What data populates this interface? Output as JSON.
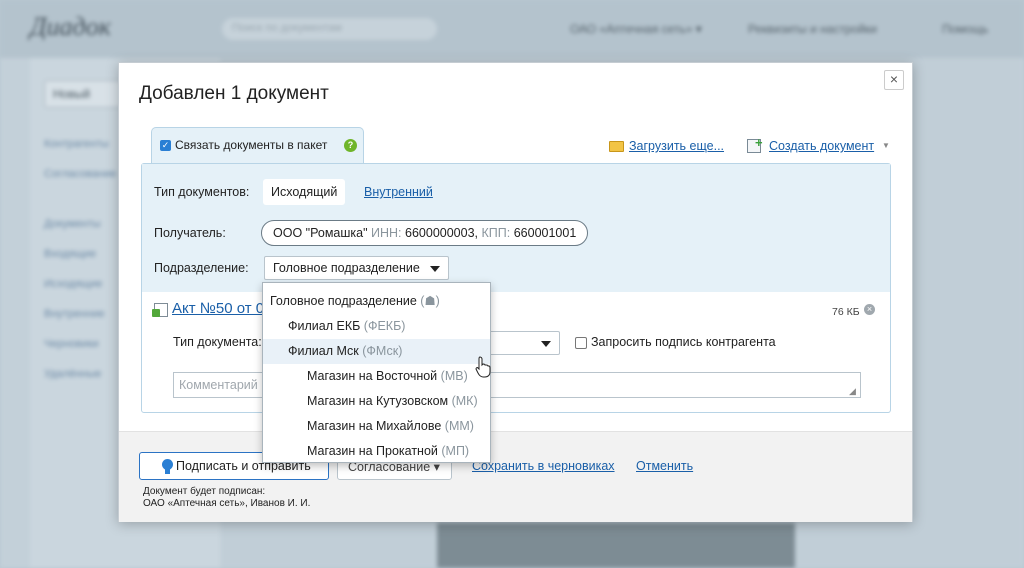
{
  "background": {
    "logo": "Диадок",
    "search_placeholder": "Поиск по документам",
    "org": "ОАО «Аптечная сеть» ▾",
    "settings": "Реквизиты и настройки",
    "help": "Помощь",
    "new_button": "Новый",
    "sidebar_links": [
      "Контрагенты",
      "Согласование",
      "Документы",
      "Входящие",
      "Исходящие",
      "Внутренние",
      "Черновики",
      "Удалённые"
    ]
  },
  "modal": {
    "title": "Добавлен 1 документ",
    "close": "×",
    "tab": {
      "label": "Связать документы в пакет",
      "help": "?"
    },
    "upload_more": "Загрузить еще...",
    "create_document": "Создать документ",
    "doc_types": {
      "label": "Тип документов:",
      "active": "Исходящий",
      "other": "Внутренний"
    },
    "recipient": {
      "label": "Получатель:",
      "name": "ООО \"Ромашка\"",
      "inn_label": "ИНН:",
      "inn": "6600000003,",
      "kpp_label": "КПП:",
      "kpp": "660001001"
    },
    "subdivision": {
      "label": "Подразделение:",
      "value": "Головное подразделение"
    },
    "document": {
      "link": "Акт №50 от 0",
      "size": "76 КБ",
      "type_label": "Тип документа:",
      "request_signature": "Запросить подпись контрагента",
      "comment_placeholder": "Комментарий"
    },
    "footer": {
      "sign_button": "Подписать и отправить",
      "approve_button": "Согласование ▾",
      "save_draft": "Сохранить в черновиках",
      "cancel": "Отменить",
      "note_line1": "Документ будет подписан:",
      "note_line2": "ОАО «Аптечная сеть», Иванов И. И."
    }
  },
  "dropdown": {
    "items": [
      {
        "name": "Головное подразделение",
        "abbr": "(☗)"
      },
      {
        "name": "Филиал ЕКБ",
        "abbr": "(ФЕКБ)"
      },
      {
        "name": "Филиал Мск",
        "abbr": "(ФМск)"
      },
      {
        "name": "Магазин на Восточной",
        "abbr": "(МВ)"
      },
      {
        "name": "Магазин на Кутузовском",
        "abbr": "(МК)"
      },
      {
        "name": "Магазин на Михайлове",
        "abbr": "(ММ)"
      },
      {
        "name": "Магазин на Прокатной",
        "abbr": "(МП)"
      }
    ]
  }
}
